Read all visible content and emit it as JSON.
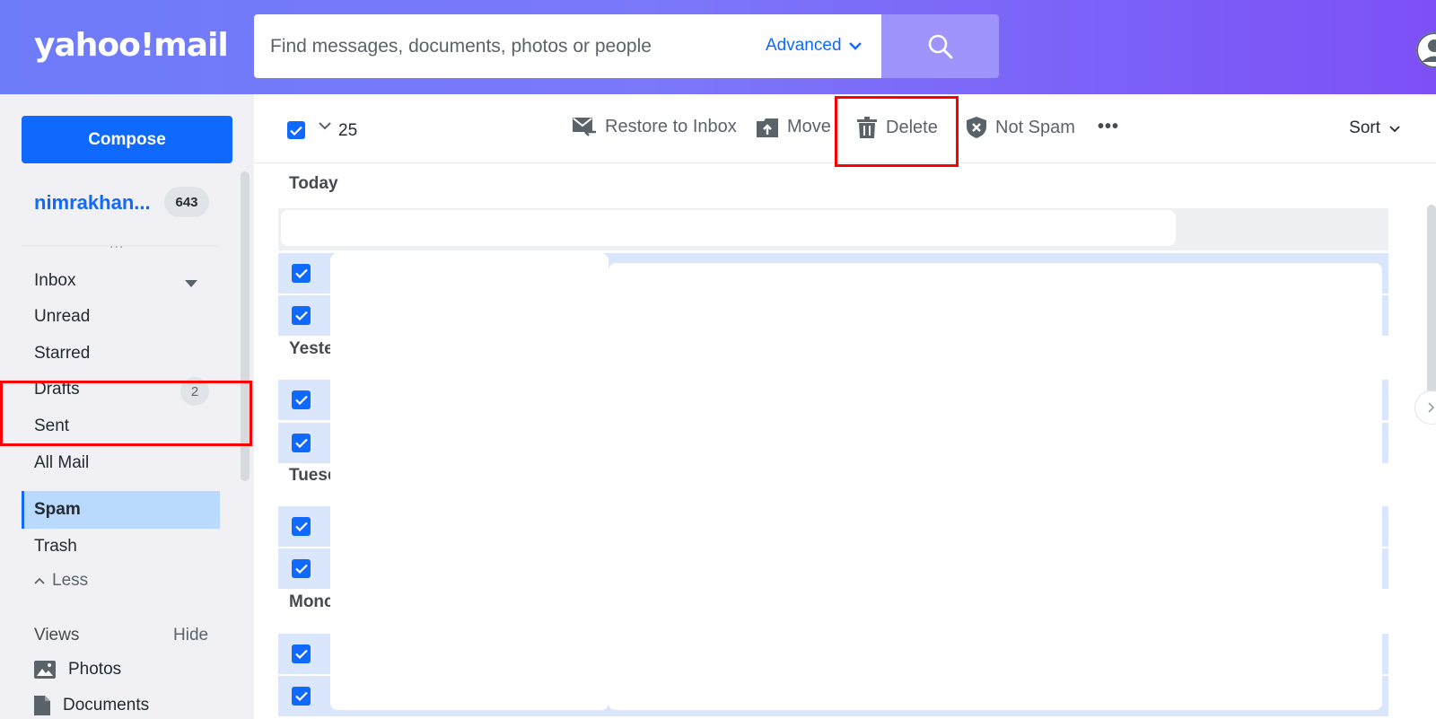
{
  "header": {
    "logo": "yahoo!mail",
    "search_placeholder": "Find messages, documents, photos or people",
    "advanced_label": "Advanced"
  },
  "sidebar": {
    "compose_label": "Compose",
    "account_name": "nimrakhan...",
    "account_count": "643",
    "more_dots": "...",
    "folders": [
      {
        "label": "Inbox"
      },
      {
        "label": "Unread"
      },
      {
        "label": "Starred"
      },
      {
        "label": "Drafts",
        "badge": "2"
      },
      {
        "label": "Sent"
      },
      {
        "label": "All Mail"
      },
      {
        "label": "Spam",
        "active": true
      },
      {
        "label": "Trash"
      }
    ],
    "less_label": "Less",
    "views_label": "Views",
    "hide_label": "Hide",
    "views": [
      {
        "label": "Photos",
        "icon": "photo-icon"
      },
      {
        "label": "Documents",
        "icon": "document-icon"
      }
    ]
  },
  "toolbar": {
    "selected_count": "25",
    "restore_label": "Restore to Inbox",
    "move_label": "Move",
    "delete_label": "Delete",
    "not_spam_label": "Not Spam",
    "more_label": "•••",
    "sort_label": "Sort"
  },
  "list": {
    "groups": [
      "Today",
      "Yeste",
      "Tuesc",
      "Monc"
    ]
  },
  "colors": {
    "accent": "#0f69ff",
    "header_start": "#6d7cf9",
    "header_end": "#7d50f6",
    "highlight": "#ff0000"
  }
}
